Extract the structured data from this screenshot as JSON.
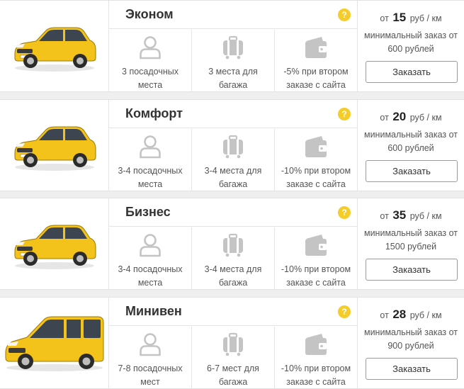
{
  "colors": {
    "taxi_yellow": "#f3c21b",
    "help_badge": "#f5cd2a",
    "icon_gray": "#c4c4c4"
  },
  "tariffs": [
    {
      "title": "Эконом",
      "help": "?",
      "seats": "3 посадочных места",
      "luggage": "3 места для багажа",
      "discount": "-5% при втором заказе с сайта",
      "price_prefix": "от",
      "price": "15",
      "price_unit": "руб / км",
      "min_order": "минимальный заказ от 600 рублей",
      "button": "Заказать",
      "car_type": "sedan"
    },
    {
      "title": "Комфорт",
      "help": "?",
      "seats": "3-4 посадочных места",
      "luggage": "3-4 места для багажа",
      "discount": "-10% при втором заказе с сайта",
      "price_prefix": "от",
      "price": "20",
      "price_unit": "руб / км",
      "min_order": "минимальный заказ от 600 рублей",
      "button": "Заказать",
      "car_type": "sedan"
    },
    {
      "title": "Бизнес",
      "help": "?",
      "seats": "3-4 посадочных места",
      "luggage": "3-4 места для багажа",
      "discount": "-10% при втором заказе с сайта",
      "price_prefix": "от",
      "price": "35",
      "price_unit": "руб / км",
      "min_order": "минимальный заказ от 1500 рублей",
      "button": "Заказать",
      "car_type": "sedan"
    },
    {
      "title": "Минивен",
      "help": "?",
      "seats": "7-8 посадочных мест",
      "luggage": "6-7 мест для багажа",
      "discount": "-10% при втором заказе с сайта",
      "price_prefix": "от",
      "price": "28",
      "price_unit": "руб / км",
      "min_order": "минимальный заказ от 900 рублей",
      "button": "Заказать",
      "car_type": "minivan"
    }
  ],
  "icons": {
    "seats": "person-icon",
    "luggage": "luggage-icon",
    "discount": "wallet-icon",
    "help": "help-icon"
  }
}
